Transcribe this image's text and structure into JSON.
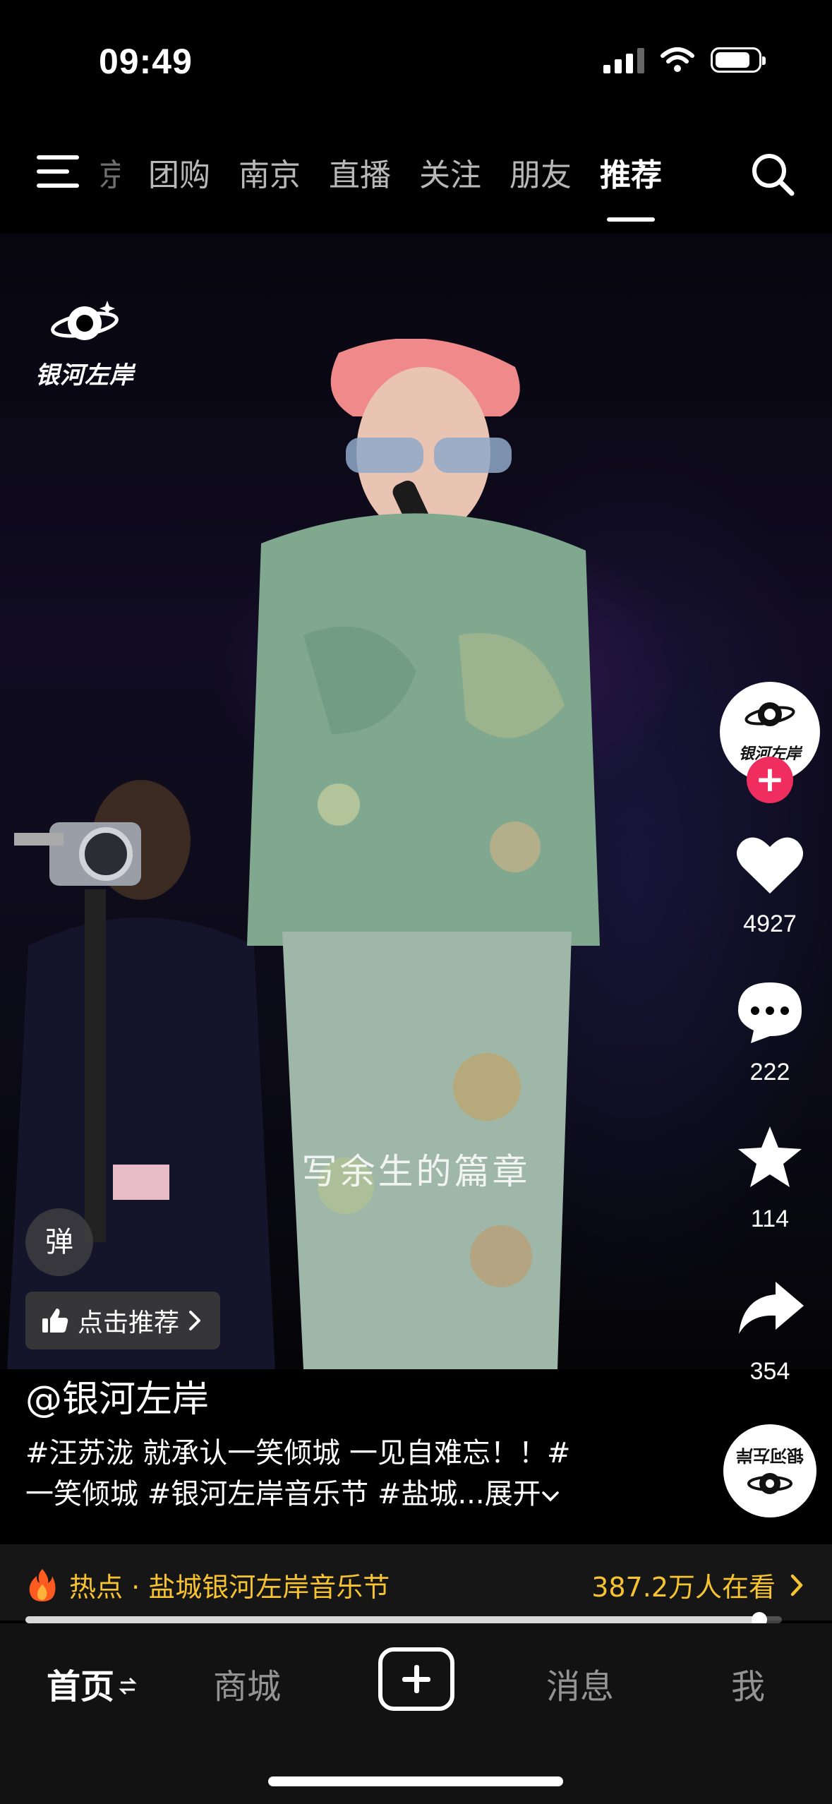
{
  "status_bar": {
    "time": "09:49"
  },
  "top_nav": {
    "tabs": [
      {
        "label": "京",
        "state": "partial"
      },
      {
        "label": "团购"
      },
      {
        "label": "南京"
      },
      {
        "label": "直播"
      },
      {
        "label": "关注"
      },
      {
        "label": "朋友"
      },
      {
        "label": "推荐",
        "state": "active"
      }
    ]
  },
  "video": {
    "watermark": "银河左岸",
    "subtitle": "写余生的篇章"
  },
  "right_rail": {
    "avatar_text": "银河左岸",
    "likes": "4927",
    "comments": "222",
    "favorites": "114",
    "shares": "354"
  },
  "overlay": {
    "danmaku_label": "弹",
    "recommend_label": "点击推荐"
  },
  "post": {
    "author": "@银河左岸",
    "caption_line1": "#汪苏泷 就承认一笑倾城 一见自难忘！！#",
    "caption_line2": "一笑倾城 #银河左岸音乐节 #盐城...",
    "expand_label": "展开"
  },
  "hot_bar": {
    "label": "热点 · 盐城银河左岸音乐节",
    "viewers": "387.2万人在看",
    "accent": "#f7c331"
  },
  "playback": {
    "progress": 0.97
  },
  "bottom_nav": {
    "home": "首页",
    "mall": "商城",
    "messages": "消息",
    "me": "我"
  },
  "colors": {
    "follow": "#f02d5f",
    "background": "#000000"
  }
}
